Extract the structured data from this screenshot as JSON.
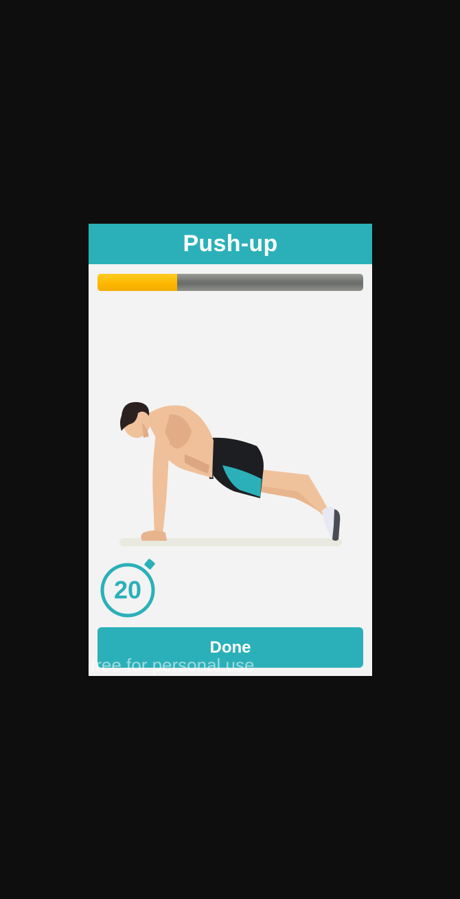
{
  "dialog": {
    "title": "Push-up",
    "progress": {
      "fraction": 0.3,
      "fill_color": "#ffbb00",
      "track_color": "#767874"
    },
    "illustration": {
      "subject": "man-doing-push-up",
      "icon": "push-up-illustration"
    },
    "timer": {
      "value": "20",
      "icon": "stopwatch-icon",
      "color": "#2bb0b9"
    },
    "done_button": {
      "label": "Done"
    },
    "watermark": "free for personal use"
  },
  "colors": {
    "accent": "#2bb0b9",
    "background": "#0e0e0e",
    "dialog_background": "#f3f3f3"
  }
}
